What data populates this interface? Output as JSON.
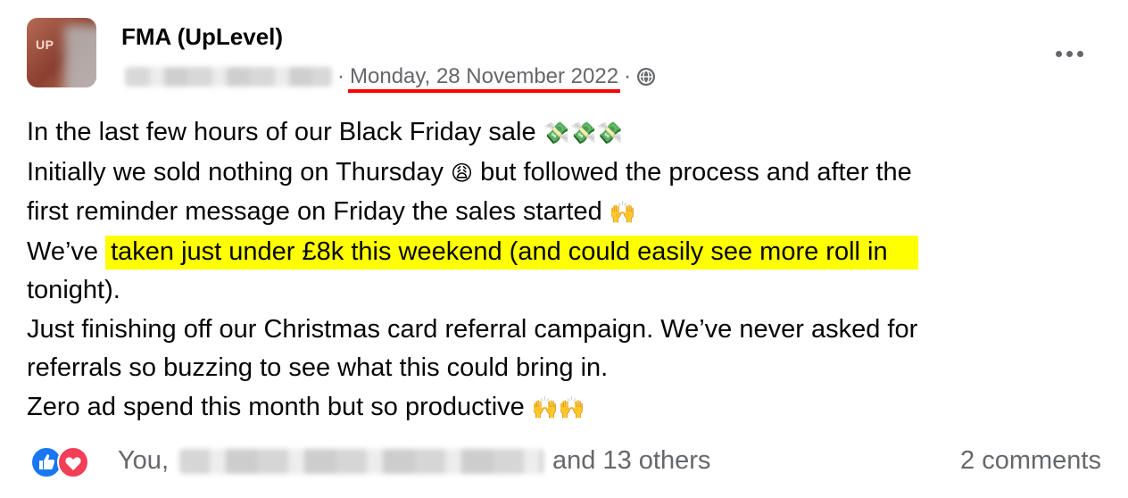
{
  "post": {
    "author": "FMA (UpLevel)",
    "avatar_text": "UP",
    "date": "Monday, 28 November 2022",
    "separator": "·",
    "lines": [
      {
        "text": "In the last few hours of our Black Friday sale ",
        "emoji": "💸💸💸"
      },
      {
        "text": "Initially we sold nothing on Thursday ",
        "emoji": "😩",
        "text2": " but followed the process and after the"
      },
      {
        "text": "first reminder message on Friday the sales started ",
        "emoji": "🙌"
      },
      {
        "prefix": "We’ve ",
        "highlight": "taken just under £8k this weekend (and could easily see more roll in"
      },
      {
        "text": "tonight)."
      },
      {
        "text": "Just finishing off our Christmas card referral campaign. We’ve never asked for"
      },
      {
        "text": "referrals so buzzing to see what this could bring in."
      },
      {
        "text": "Zero ad spend this month but so productive ",
        "emoji": "🙌🙌"
      }
    ]
  },
  "footer": {
    "reactions_prefix": "You,",
    "reactions_suffix": "and 13 others",
    "comments": "2 comments"
  },
  "colors": {
    "highlight": "#ffff00",
    "underline": "#ff0000",
    "like_blue": "#1877f2",
    "love_red": "#f33e58",
    "secondary_text": "#65676b"
  },
  "icons": [
    "globe-icon",
    "more-options-icon",
    "like-reaction-icon",
    "love-reaction-icon"
  ]
}
